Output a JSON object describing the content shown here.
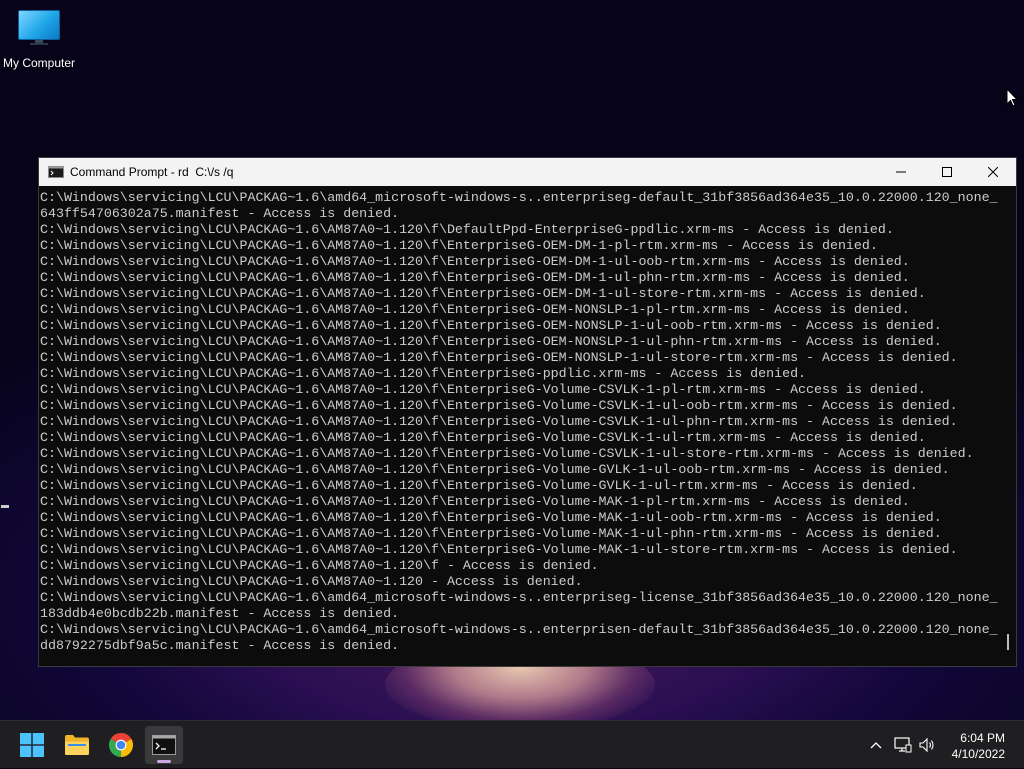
{
  "desktop": {
    "icons": [
      {
        "label": "My Computer",
        "icon": "computer-monitor-icon"
      }
    ]
  },
  "window": {
    "title": "Command Prompt - rd  C:\\/s /q",
    "icon": "command-prompt-icon",
    "controls": {
      "minimize": "minimize-icon",
      "maximize": "maximize-icon",
      "close": "close-icon"
    },
    "console_lines": [
      "C:\\Windows\\servicing\\LCU\\PACKAG~1.6\\amd64_microsoft-windows-s..enterpriseg-default_31bf3856ad364e35_10.0.22000.120_none_",
      "643ff54706302a75.manifest - Access is denied.",
      "C:\\Windows\\servicing\\LCU\\PACKAG~1.6\\AM87A0~1.120\\f\\DefaultPpd-EnterpriseG-ppdlic.xrm-ms - Access is denied.",
      "C:\\Windows\\servicing\\LCU\\PACKAG~1.6\\AM87A0~1.120\\f\\EnterpriseG-OEM-DM-1-pl-rtm.xrm-ms - Access is denied.",
      "C:\\Windows\\servicing\\LCU\\PACKAG~1.6\\AM87A0~1.120\\f\\EnterpriseG-OEM-DM-1-ul-oob-rtm.xrm-ms - Access is denied.",
      "C:\\Windows\\servicing\\LCU\\PACKAG~1.6\\AM87A0~1.120\\f\\EnterpriseG-OEM-DM-1-ul-phn-rtm.xrm-ms - Access is denied.",
      "C:\\Windows\\servicing\\LCU\\PACKAG~1.6\\AM87A0~1.120\\f\\EnterpriseG-OEM-DM-1-ul-store-rtm.xrm-ms - Access is denied.",
      "C:\\Windows\\servicing\\LCU\\PACKAG~1.6\\AM87A0~1.120\\f\\EnterpriseG-OEM-NONSLP-1-pl-rtm.xrm-ms - Access is denied.",
      "C:\\Windows\\servicing\\LCU\\PACKAG~1.6\\AM87A0~1.120\\f\\EnterpriseG-OEM-NONSLP-1-ul-oob-rtm.xrm-ms - Access is denied.",
      "C:\\Windows\\servicing\\LCU\\PACKAG~1.6\\AM87A0~1.120\\f\\EnterpriseG-OEM-NONSLP-1-ul-phn-rtm.xrm-ms - Access is denied.",
      "C:\\Windows\\servicing\\LCU\\PACKAG~1.6\\AM87A0~1.120\\f\\EnterpriseG-OEM-NONSLP-1-ul-store-rtm.xrm-ms - Access is denied.",
      "C:\\Windows\\servicing\\LCU\\PACKAG~1.6\\AM87A0~1.120\\f\\EnterpriseG-ppdlic.xrm-ms - Access is denied.",
      "C:\\Windows\\servicing\\LCU\\PACKAG~1.6\\AM87A0~1.120\\f\\EnterpriseG-Volume-CSVLK-1-pl-rtm.xrm-ms - Access is denied.",
      "C:\\Windows\\servicing\\LCU\\PACKAG~1.6\\AM87A0~1.120\\f\\EnterpriseG-Volume-CSVLK-1-ul-oob-rtm.xrm-ms - Access is denied.",
      "C:\\Windows\\servicing\\LCU\\PACKAG~1.6\\AM87A0~1.120\\f\\EnterpriseG-Volume-CSVLK-1-ul-phn-rtm.xrm-ms - Access is denied.",
      "C:\\Windows\\servicing\\LCU\\PACKAG~1.6\\AM87A0~1.120\\f\\EnterpriseG-Volume-CSVLK-1-ul-rtm.xrm-ms - Access is denied.",
      "C:\\Windows\\servicing\\LCU\\PACKAG~1.6\\AM87A0~1.120\\f\\EnterpriseG-Volume-CSVLK-1-ul-store-rtm.xrm-ms - Access is denied.",
      "C:\\Windows\\servicing\\LCU\\PACKAG~1.6\\AM87A0~1.120\\f\\EnterpriseG-Volume-GVLK-1-ul-oob-rtm.xrm-ms - Access is denied.",
      "C:\\Windows\\servicing\\LCU\\PACKAG~1.6\\AM87A0~1.120\\f\\EnterpriseG-Volume-GVLK-1-ul-rtm.xrm-ms - Access is denied.",
      "C:\\Windows\\servicing\\LCU\\PACKAG~1.6\\AM87A0~1.120\\f\\EnterpriseG-Volume-MAK-1-pl-rtm.xrm-ms - Access is denied.",
      "C:\\Windows\\servicing\\LCU\\PACKAG~1.6\\AM87A0~1.120\\f\\EnterpriseG-Volume-MAK-1-ul-oob-rtm.xrm-ms - Access is denied.",
      "C:\\Windows\\servicing\\LCU\\PACKAG~1.6\\AM87A0~1.120\\f\\EnterpriseG-Volume-MAK-1-ul-phn-rtm.xrm-ms - Access is denied.",
      "C:\\Windows\\servicing\\LCU\\PACKAG~1.6\\AM87A0~1.120\\f\\EnterpriseG-Volume-MAK-1-ul-store-rtm.xrm-ms - Access is denied.",
      "C:\\Windows\\servicing\\LCU\\PACKAG~1.6\\AM87A0~1.120\\f - Access is denied.",
      "C:\\Windows\\servicing\\LCU\\PACKAG~1.6\\AM87A0~1.120 - Access is denied.",
      "C:\\Windows\\servicing\\LCU\\PACKAG~1.6\\amd64_microsoft-windows-s..enterpriseg-license_31bf3856ad364e35_10.0.22000.120_none_",
      "183ddb4e0bcdb22b.manifest - Access is denied.",
      "C:\\Windows\\servicing\\LCU\\PACKAG~1.6\\amd64_microsoft-windows-s..enterprisen-default_31bf3856ad364e35_10.0.22000.120_none_",
      "dd8792275dbf9a5c.manifest - Access is denied."
    ],
    "colors": {
      "console_bg": "#0c0c0c",
      "console_text": "#cccccc",
      "titlebar_bg": "#f3f3f3"
    }
  },
  "taskbar": {
    "apps": [
      {
        "name": "start",
        "icon": "windows-start-icon"
      },
      {
        "name": "file-explorer",
        "icon": "folder-icon"
      },
      {
        "name": "chrome",
        "icon": "chrome-icon"
      },
      {
        "name": "command-prompt",
        "icon": "command-prompt-icon",
        "active": true
      }
    ],
    "tray": {
      "icons": [
        "chevron-up-icon",
        "network-icon",
        "volume-icon"
      ]
    },
    "clock": {
      "time": "6:04 PM",
      "date": "4/10/2022"
    }
  }
}
